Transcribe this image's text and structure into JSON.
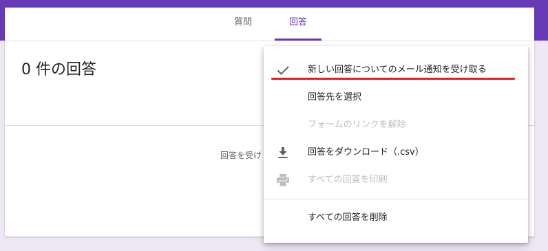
{
  "tabs": {
    "questions": "質問",
    "responses": "回答"
  },
  "main": {
    "response_count_title": "0 件の回答",
    "accepting_text": "回答を受け"
  },
  "menu": {
    "items": [
      {
        "label": "新しい回答についてのメール通知を受け取る",
        "icon": "check-icon",
        "checked": true,
        "enabled": true
      },
      {
        "label": "回答先を選択",
        "icon": "",
        "enabled": true
      },
      {
        "label": "フォームのリンクを解除",
        "icon": "",
        "enabled": false
      },
      {
        "label": "回答をダウンロード（.csv）",
        "icon": "download-icon",
        "enabled": true
      },
      {
        "label": "すべての回答を印刷",
        "icon": "print-icon",
        "enabled": false
      },
      {
        "label": "すべての回答を削除",
        "icon": "",
        "enabled": true
      }
    ]
  },
  "colors": {
    "brand": "#673ab7",
    "background": "#ede7f6",
    "annotation": "#e51c23",
    "disabled_text": "#bdbdbd"
  }
}
